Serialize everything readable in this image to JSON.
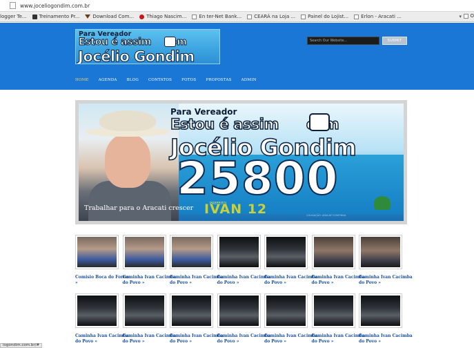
{
  "browser": {
    "url": "www.joceliogondim.com.br",
    "bookmarks": [
      {
        "label": "logger Te...",
        "icon": "none"
      },
      {
        "label": "Treinamento Pr...",
        "icon": "blogger-icon"
      },
      {
        "label": "Download Com...",
        "icon": "download-icon"
      },
      {
        "label": "Thiago Nascim...",
        "icon": "red-circle-icon"
      },
      {
        "label": "En ter-Net Bank...",
        "icon": "doc-icon"
      },
      {
        "label": "CEARÁ na Loja ...",
        "icon": "doc-icon"
      },
      {
        "label": "Painel do Lojist...",
        "icon": "doc-icon"
      },
      {
        "label": "Erlon - Aracati ...",
        "icon": "doc-icon"
      }
    ],
    "bookmarks_overflow": "▾",
    "bookmarks_extra": "O",
    "status": "iogondim.com.br/#"
  },
  "header": {
    "logo": {
      "line1": "Para Vereador",
      "line2": "Estou é assim",
      "line2b": "com",
      "line3": "Jocélio Gondim"
    },
    "search_placeholder": "Search Our Website...",
    "submit_label": "SUBMIT",
    "nav": [
      {
        "label": "HOME",
        "active": true
      },
      {
        "label": "AGENDA",
        "active": false
      },
      {
        "label": "BLOG",
        "active": false
      },
      {
        "label": "CONTATOS",
        "active": false
      },
      {
        "label": "FOTOS",
        "active": false
      },
      {
        "label": "PROPOSTAS",
        "active": false
      },
      {
        "label": "ADMIN",
        "active": false
      }
    ],
    "colors": {
      "header_bg": "#1a77d6",
      "nav_active": "#f5d65a"
    }
  },
  "banner": {
    "line1": "Para Vereador",
    "line2": "Estou é assim",
    "line2b": "com",
    "line3": "Jocélio Gondim",
    "number": "25800",
    "caption": "Trabalhar para o Aracati crescer",
    "prefeito_label": "PREFEITO",
    "prefeito_name": "IVAN 12",
    "coalition": "COLIGAÇÃO: ARACATI CONTINUA"
  },
  "gallery": {
    "items": [
      {
        "label": "Comisio Boca do Forno »",
        "tone": "light"
      },
      {
        "label": "Caminha Ivan Cacimba do Povo »",
        "tone": "light"
      },
      {
        "label": "Caminha Ivan Cacimba do Povo »",
        "tone": "light"
      },
      {
        "label": "Caminha Ivan Cacimba do Povo »",
        "tone": "dark"
      },
      {
        "label": "Caminha Ivan Cacimba do Povo »",
        "tone": "dark"
      },
      {
        "label": "Caminha Ivan Cacimba do Povo »",
        "tone": "mid"
      },
      {
        "label": "Caminha Ivan Cacimba do Povo »",
        "tone": "mid"
      },
      {
        "label": "Caminha Ivan Cacimba do Povo »",
        "tone": "dark"
      },
      {
        "label": "Caminha Ivan Cacimba do Povo »",
        "tone": "dark"
      },
      {
        "label": "Caminha Ivan Cacimba do Povo »",
        "tone": "dark"
      },
      {
        "label": "Caminha Ivan Cacimba do Povo »",
        "tone": "dark"
      },
      {
        "label": "Caminha Ivan Cacimba do Povo »",
        "tone": "dark"
      },
      {
        "label": "Caminha Ivan Cacimba do Povo »",
        "tone": "dark"
      },
      {
        "label": "Caminha Ivan Cacimba do Povo »",
        "tone": "dark"
      }
    ]
  }
}
